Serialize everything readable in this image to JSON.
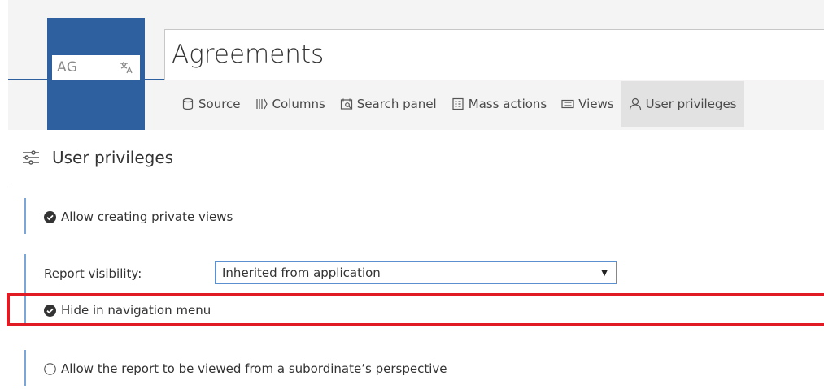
{
  "header": {
    "logo_text": "AG",
    "title": "Agreements"
  },
  "tabs": [
    {
      "label": "Source",
      "icon": "database-icon",
      "active": false
    },
    {
      "label": "Columns",
      "icon": "columns-icon",
      "active": false
    },
    {
      "label": "Search panel",
      "icon": "search-panel-icon",
      "active": false
    },
    {
      "label": "Mass actions",
      "icon": "mass-actions-icon",
      "active": false
    },
    {
      "label": "Views",
      "icon": "views-icon",
      "active": false
    },
    {
      "label": "User privileges",
      "icon": "user-icon",
      "active": true
    }
  ],
  "section": {
    "title": "User privileges",
    "icon": "sliders-icon"
  },
  "options": {
    "private_views": {
      "label": "Allow creating private views",
      "checked": true
    },
    "report_visibility": {
      "label": "Report visibility:",
      "value": "Inherited from application"
    },
    "hide_nav": {
      "label": "Hide in navigation menu",
      "checked": true
    },
    "subordinate": {
      "label": "Allow the report to be viewed from a subordinate’s perspective",
      "checked": false
    }
  },
  "colors": {
    "brand": "#2e5f9e",
    "accent_bar": "#7aa6d8",
    "highlight": "#e01b24"
  }
}
